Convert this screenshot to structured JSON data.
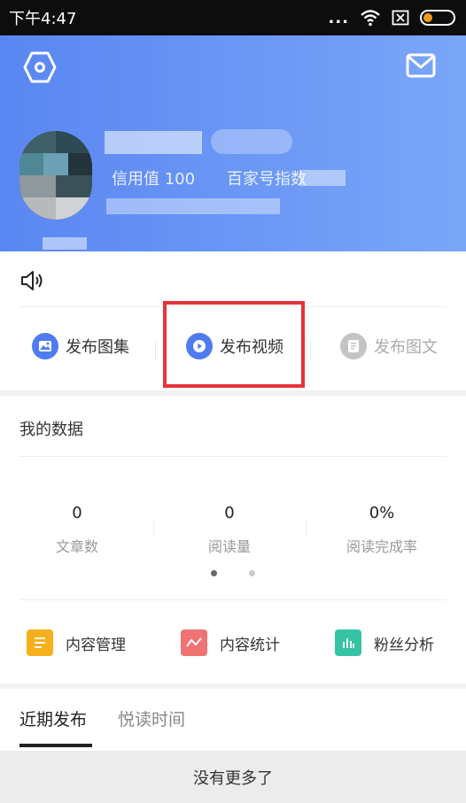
{
  "status_bar": {
    "time": "下午4:47",
    "dots": "..."
  },
  "profile": {
    "credit": "信用值 100",
    "baijia_index": "百家号指数"
  },
  "publish": {
    "items": [
      {
        "label": "发布图集",
        "icon": "image-icon"
      },
      {
        "label": "发布视频",
        "icon": "video-icon"
      },
      {
        "label": "发布图文",
        "icon": "document-icon"
      }
    ]
  },
  "my_data": {
    "title": "我的数据",
    "stats": [
      {
        "value": "0",
        "label": "文章数"
      },
      {
        "value": "0",
        "label": "阅读量"
      },
      {
        "value": "0%",
        "label": "阅读完成率"
      }
    ],
    "tools": [
      {
        "label": "内容管理",
        "icon": "content-management-icon",
        "color": "#f6b01c"
      },
      {
        "label": "内容统计",
        "icon": "content-stats-icon",
        "color": "#f07373"
      },
      {
        "label": "粉丝分析",
        "icon": "fans-analysis-icon",
        "color": "#35c3a4"
      }
    ]
  },
  "recent": {
    "tabs": [
      {
        "label": "近期发布"
      },
      {
        "label": "悦读时间"
      }
    ]
  },
  "footer": {
    "text": "没有更多了"
  },
  "colors": {
    "header_start": "#5a86f2",
    "header_end": "#7aa6f8",
    "highlight": "#e6323a",
    "blue_icon": "#4e7cf0"
  }
}
